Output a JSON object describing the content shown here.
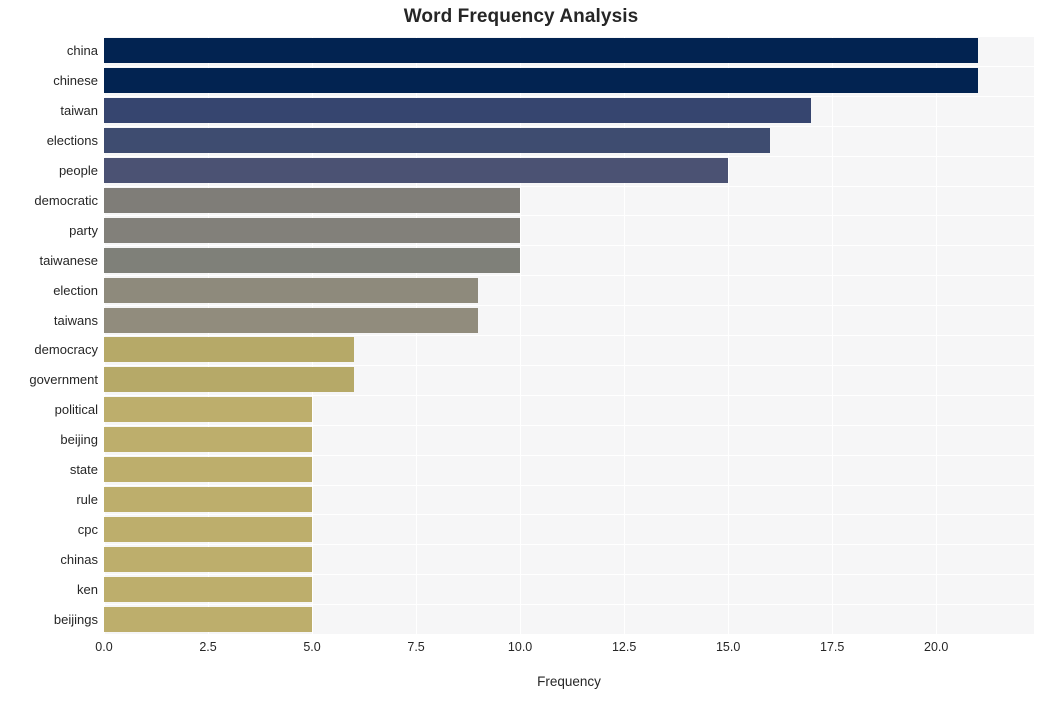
{
  "chart_data": {
    "type": "bar",
    "orientation": "horizontal",
    "title": "Word Frequency Analysis",
    "xlabel": "Frequency",
    "ylabel": "",
    "xlim": [
      0,
      22.35
    ],
    "xticks": [
      0,
      2.5,
      5,
      7.5,
      10,
      12.5,
      15,
      17.5,
      20
    ],
    "xticklabels": [
      "0.0",
      "2.5",
      "5.0",
      "7.5",
      "10.0",
      "12.5",
      "15.0",
      "17.5",
      "20.0"
    ],
    "grid": true,
    "legend": false,
    "categories": [
      "china",
      "chinese",
      "taiwan",
      "elections",
      "people",
      "democratic",
      "party",
      "taiwanese",
      "election",
      "taiwans",
      "democracy",
      "government",
      "political",
      "beijing",
      "state",
      "rule",
      "cpc",
      "chinas",
      "ken",
      "beijings"
    ],
    "values": [
      21,
      21,
      17,
      16,
      15,
      10,
      10,
      10,
      9,
      9,
      6,
      6,
      5,
      5,
      5,
      5,
      5,
      5,
      5,
      5
    ],
    "bar_colors": [
      "#022351",
      "#022351",
      "#36456f",
      "#3e4c70",
      "#4b5273",
      "#7f7d78",
      "#82807a",
      "#7f8079",
      "#8e8a7c",
      "#918c7d",
      "#b6a968",
      "#b6a968",
      "#bdae6c",
      "#bdae6c",
      "#bdae6c",
      "#bdae6c",
      "#bdae6c",
      "#bdae6c",
      "#bdae6c",
      "#bdae6c"
    ],
    "plot_background": "#f6f6f7",
    "gridline_color": "#ffffff",
    "text_color": "#262626"
  }
}
